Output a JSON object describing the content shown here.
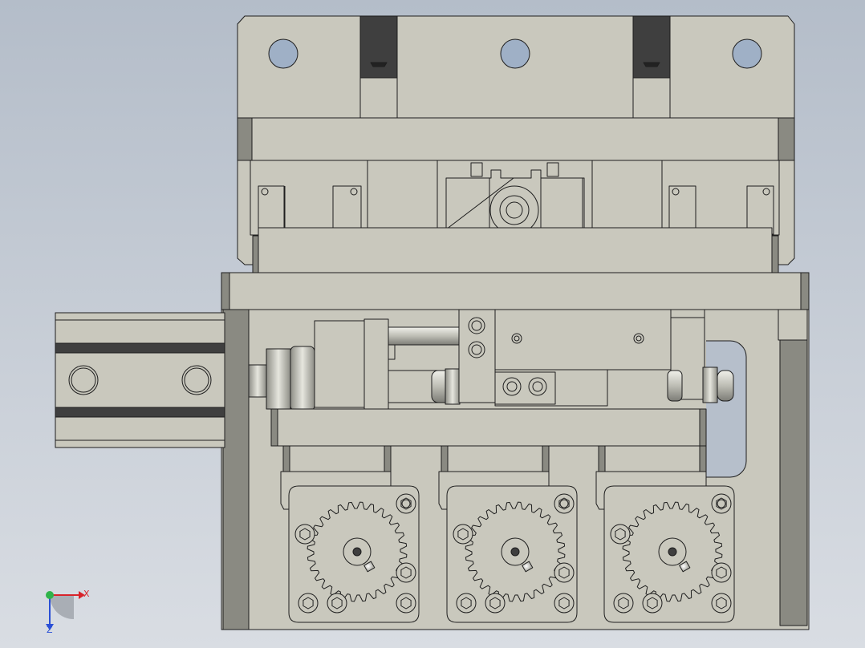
{
  "scene": {
    "description_hidden": false,
    "background_top": "#b9c1cc",
    "background_bottom": "#d7dbe1",
    "part_fill": "#c9c8bd",
    "part_dark": "#8a8a82",
    "slot_dark": "#3f3f3f",
    "edge_color": "#1e1e1e"
  },
  "triad": {
    "x_label": "X",
    "z_label": "Z",
    "x_color": "#d8232a",
    "y_color": "#2fb34a",
    "z_color": "#2a4fd6"
  },
  "gears": {
    "count": 3,
    "teeth": 28
  }
}
